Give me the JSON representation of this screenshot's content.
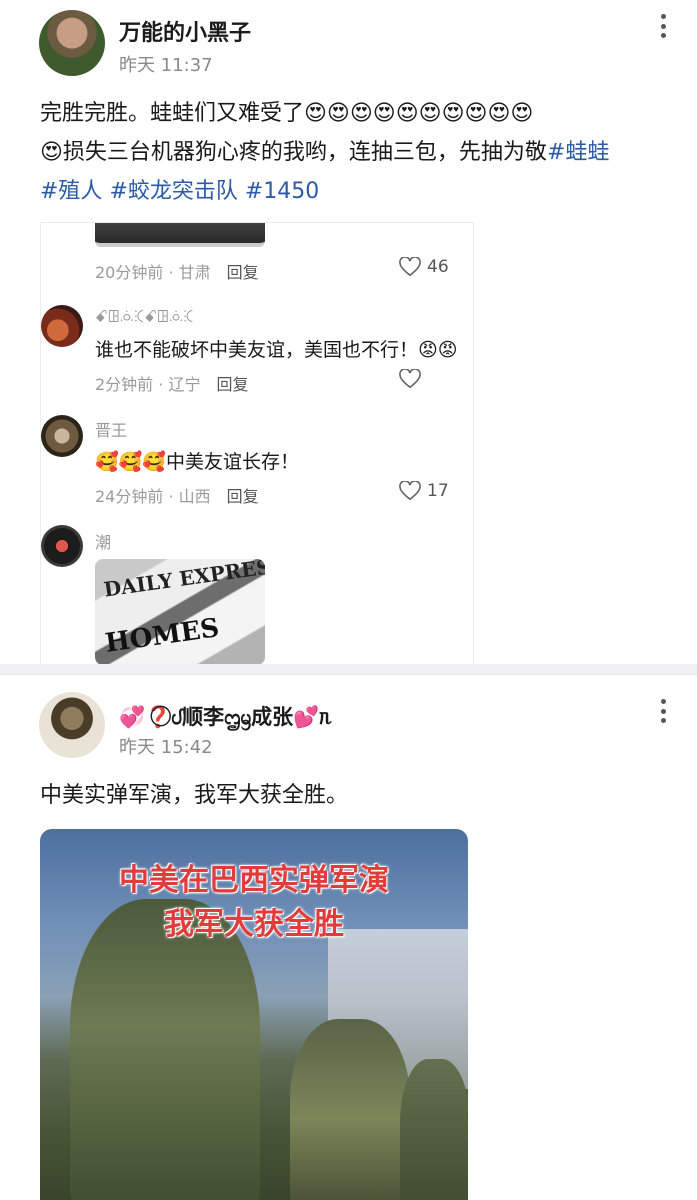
{
  "post1": {
    "author": "万能的小黑子",
    "time": "昨天 11:37",
    "text_line1": "完胜完胜。蛙蛙们又难受了😍😍😍😍😍😍😍😍😍😍",
    "text_line2_a": "😍损失三台机器狗心疼的我哟，连抽三包，先抽为敬",
    "hashtag1": "#蛙蛙",
    "hashtag2": "#殖人",
    "hashtag3": "#蛟龙突击队",
    "hashtag4": "#1450",
    "embed": {
      "comment0": {
        "meta_time": "20分钟前 · 甘肃",
        "reply": "回复",
        "likes": "46"
      },
      "comment1": {
        "name": "ꗃꖸꗝꕿꗃꖸꗝꕿ",
        "text": "谁也不能破坏中美友谊，美国也不行！😡😡",
        "meta_time": "2分钟前 · 辽宁",
        "reply": "回复"
      },
      "comment2": {
        "name": "晋王",
        "text": "🥰🥰🥰中美友谊长存！",
        "meta_time": "24分钟前 · 山西",
        "reply": "回复",
        "likes": "17"
      },
      "comment3": {
        "name": "潮",
        "image_text_top": "DAILY EXPRESS",
        "image_text_bottom": "HOMES"
      }
    }
  },
  "post2": {
    "author": "💞❓⃝ᦔ顺李ᦗᦙ成张💕ᥰ",
    "time": "昨天 15:42",
    "text": "中美实弹军演，我军大获全胜。",
    "video_caption1": "中美在巴西实弹军演",
    "video_caption2": "我军大获全胜"
  },
  "icons": [
    "more-vertical-icon",
    "heart-icon"
  ],
  "colors": {
    "hashtag": "#2a5aa8",
    "caption": "#e23b3b"
  }
}
